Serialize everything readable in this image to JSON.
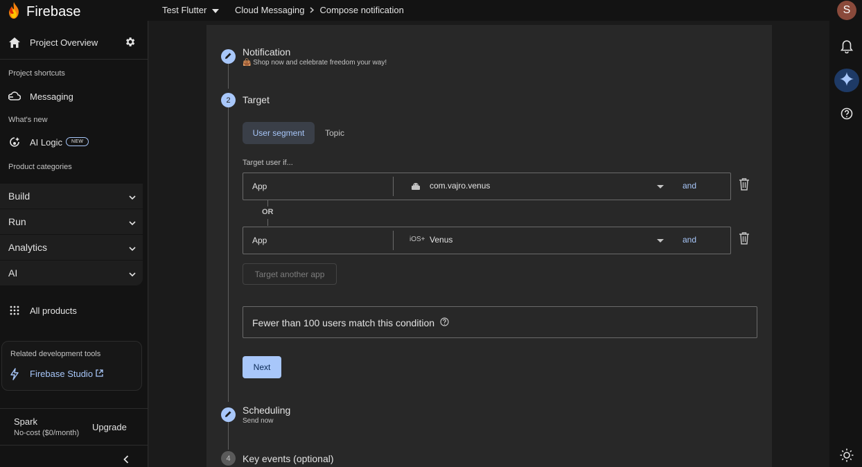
{
  "brand": {
    "name": "Firebase"
  },
  "header": {
    "project": "Test Flutter",
    "breadcrumb": [
      "Cloud Messaging",
      "Compose notification"
    ]
  },
  "sidebar": {
    "project_overview": "Project Overview",
    "shortcuts_label": "Project shortcuts",
    "messaging": "Messaging",
    "whats_new_label": "What's new",
    "ai_logic": "AI Logic",
    "new_badge": "NEW",
    "categories_label": "Product categories",
    "categories": [
      "Build",
      "Run",
      "Analytics",
      "AI"
    ],
    "all_products": "All products",
    "tools_label": "Related development tools",
    "studio": "Firebase Studio",
    "plan_name": "Spark",
    "plan_cost": "No-cost ($0/month)",
    "upgrade": "Upgrade"
  },
  "steps": {
    "notification": {
      "title": "Notification",
      "sub": "👜 Shop now and celebrate freedom your way!"
    },
    "target": {
      "number": "2",
      "title": "Target"
    },
    "scheduling": {
      "title": "Scheduling",
      "sub": "Send now"
    },
    "key_events": {
      "number": "4",
      "title": "Key events (optional)"
    }
  },
  "target": {
    "tabs": [
      "User segment",
      "Topic"
    ],
    "target_if": "Target user if...",
    "conditions": [
      {
        "field": "App",
        "platform_icon": "android-icon",
        "value": "com.vajro.venus",
        "connector": "and"
      },
      {
        "field": "App",
        "platform_icon": "ios-icon",
        "platform_text": "iOS+",
        "value": "Venus",
        "connector": "and"
      }
    ],
    "or_label": "OR",
    "another_app": "Target another app",
    "reach": "Fewer than 100 users match this condition",
    "next": "Next"
  },
  "colors": {
    "accent": "#a8c7fa",
    "panel": "#282828",
    "background": "#131313"
  }
}
